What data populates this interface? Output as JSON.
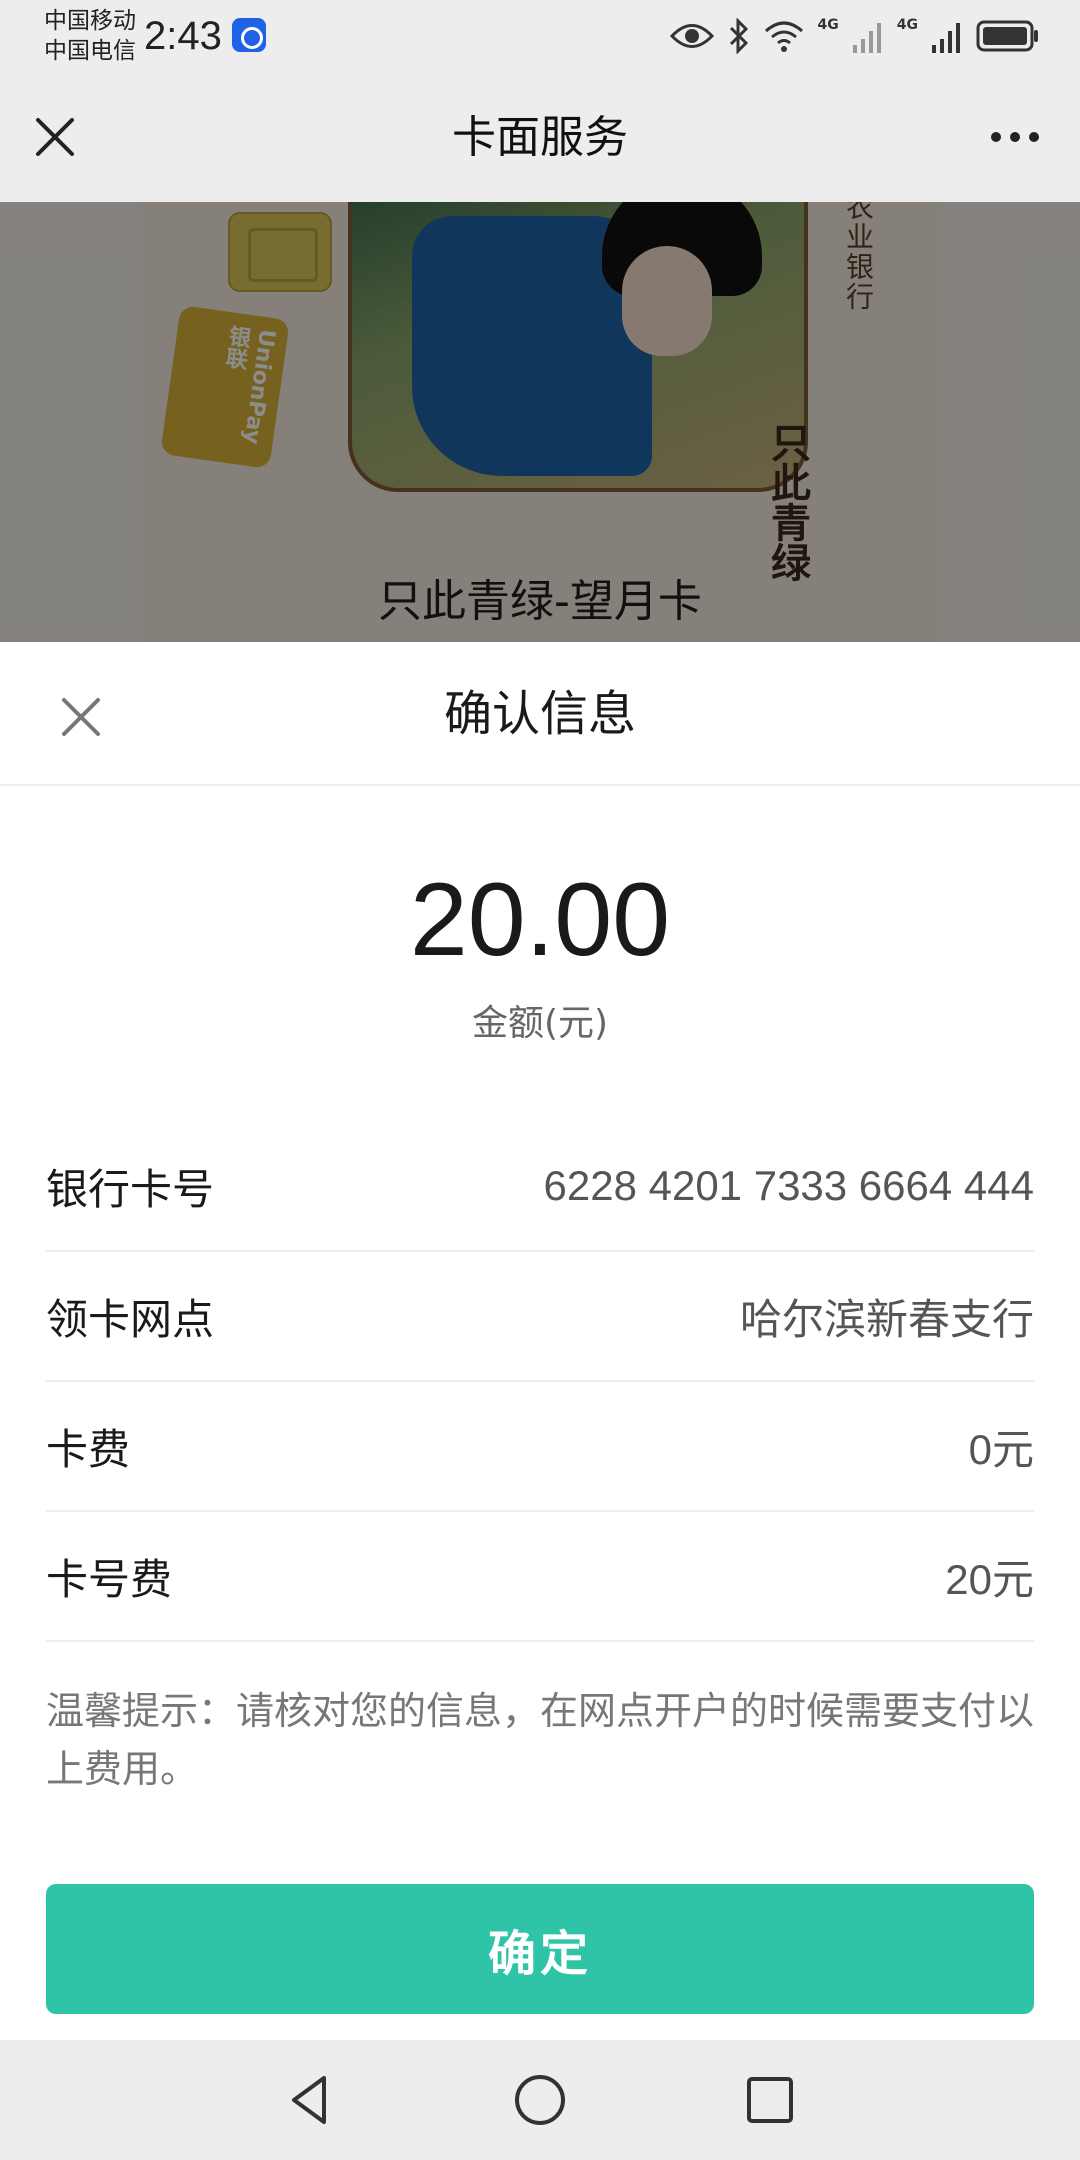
{
  "status_bar": {
    "carrier_1": "中国移动",
    "carrier_2": "中国电信",
    "time": "2:43",
    "network_1": "4G",
    "network_2": "4G",
    "icons": [
      "app-badge-icon",
      "eye-icon",
      "bluetooth-icon",
      "wifi-icon",
      "signal-icon",
      "signal-icon",
      "battery-icon"
    ]
  },
  "nav": {
    "title": "卡面服务",
    "close_icon": "close-icon",
    "more_icon": "more-icon"
  },
  "card": {
    "name": "只此青绿-望月卡",
    "bank_text": "农业银行",
    "union_pay_text": "UnionPay 银联",
    "calligraphy": "只此青绿"
  },
  "sheet": {
    "title": "确认信息",
    "amount": "20.00",
    "amount_label": "金额(元)",
    "rows": [
      {
        "label": "银行卡号",
        "value": "6228 4201 7333 6664 444"
      },
      {
        "label": "领卡网点",
        "value": "哈尔滨新春支行"
      },
      {
        "label": "卡费",
        "value": "0元"
      },
      {
        "label": "卡号费",
        "value": "20元"
      }
    ],
    "tip": "温馨提示：请核对您的信息，在网点开户的时候需要支付以上费用。",
    "confirm_label": "确定"
  },
  "colors": {
    "accent": "#2fc4a8",
    "bar_background": "#ededed"
  }
}
